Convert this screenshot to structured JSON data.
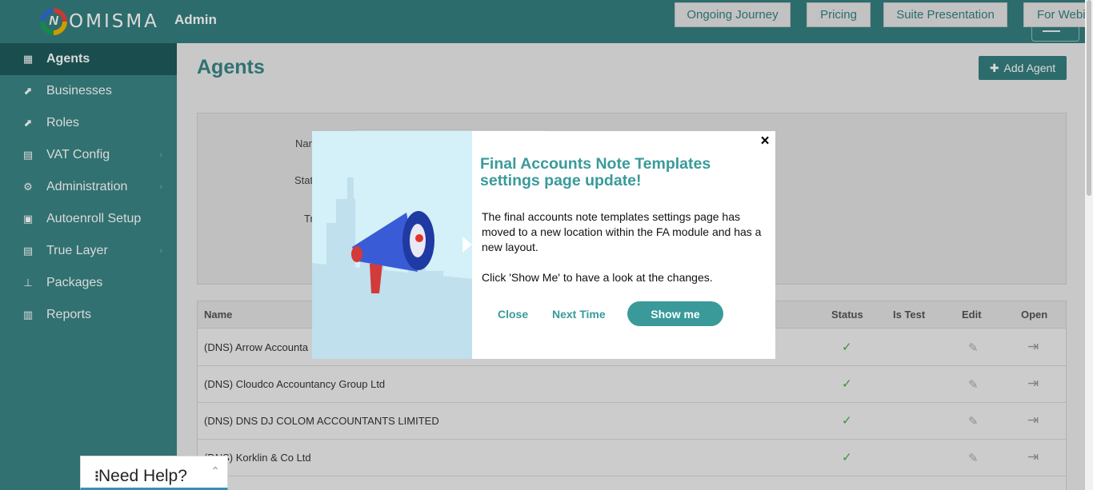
{
  "brand": {
    "logo_letter": "N",
    "logo_text": "OMISMA",
    "section": "Admin"
  },
  "top_nav": [
    "Ongoing Journey",
    "Pricing",
    "Suite Presentation",
    "For Webin"
  ],
  "sidebar": {
    "items": [
      {
        "label": "Agents",
        "icon": "dashboard-icon",
        "active": true,
        "chevron": false
      },
      {
        "label": "Businesses",
        "icon": "chart-icon",
        "chevron": false
      },
      {
        "label": "Roles",
        "icon": "chart-icon",
        "chevron": false
      },
      {
        "label": "VAT Config",
        "icon": "receipt-icon",
        "chevron": true
      },
      {
        "label": "Administration",
        "icon": "cogs-icon",
        "chevron": true
      },
      {
        "label": "Autoenroll Setup",
        "icon": "document-icon",
        "chevron": false
      },
      {
        "label": "True Layer",
        "icon": "receipt-icon",
        "chevron": true
      },
      {
        "label": "Packages",
        "icon": "sitemap-icon",
        "chevron": false
      },
      {
        "label": "Reports",
        "icon": "clipboard-icon",
        "chevron": false
      }
    ]
  },
  "page": {
    "title": "Agents",
    "add_button": "Add Agent",
    "filter_labels": [
      "Nam",
      "Stat",
      "Tr"
    ]
  },
  "table": {
    "headers": {
      "name": "Name",
      "status": "Status",
      "is_test": "Is Test",
      "edit": "Edit",
      "open": "Open"
    },
    "rows": [
      {
        "name": "(DNS) Arrow Accounta",
        "status": "✓"
      },
      {
        "name": "(DNS) Cloudco Accountancy Group Ltd",
        "status": "✓"
      },
      {
        "name": "(DNS) DNS DJ COLOM ACCOUNTANTS LIMITED",
        "status": "✓"
      },
      {
        "name": "(DNS) Korklin & Co Ltd",
        "status": "✓"
      }
    ]
  },
  "modal": {
    "close_x": "×",
    "title": "Final Accounts Note Templates settings page update!",
    "body_1": "The final accounts note templates settings page has moved to a new location within the FA module and has a new layout.",
    "body_2": "Click 'Show Me' to have a look at the changes.",
    "btn_close": "Close",
    "btn_next": "Next Time",
    "btn_show": "Show me"
  },
  "help_widget": {
    "label": "Need Help?"
  },
  "colors": {
    "teal": "#367f7f",
    "sidebar": "#3a8585",
    "active": "#1f5c5c",
    "accent": "#3a9a9a"
  }
}
